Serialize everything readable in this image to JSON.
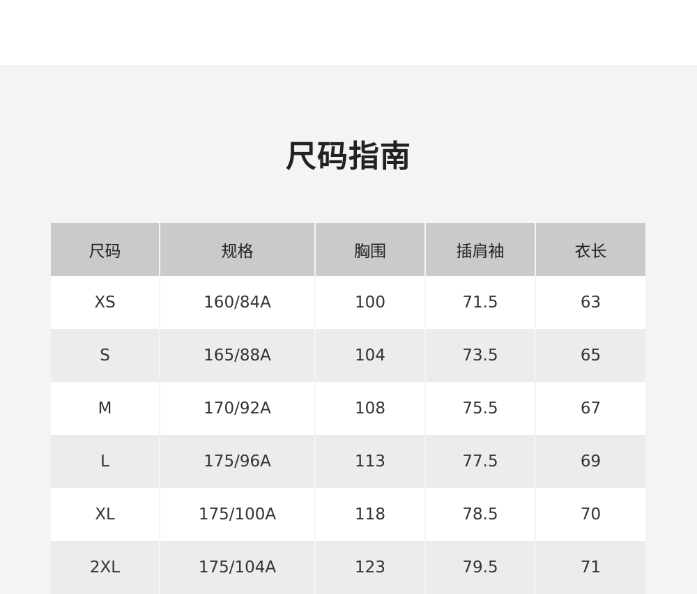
{
  "title": "尺码指南",
  "table": {
    "headers": [
      "尺码",
      "规格",
      "胸围",
      "插肩袖",
      "衣长"
    ],
    "rows": [
      [
        "XS",
        "160/84A",
        "100",
        "71.5",
        "63"
      ],
      [
        "S",
        "165/88A",
        "104",
        "73.5",
        "65"
      ],
      [
        "M",
        "170/92A",
        "108",
        "75.5",
        "67"
      ],
      [
        "L",
        "175/96A",
        "113",
        "77.5",
        "69"
      ],
      [
        "XL",
        "175/100A",
        "118",
        "78.5",
        "70"
      ],
      [
        "2XL",
        "175/104A",
        "123",
        "79.5",
        "71"
      ]
    ]
  },
  "colors": {
    "panel_background": "#f4f4f4",
    "header_background": "#cacaca",
    "row_odd": "#ffffff",
    "row_even": "#ececec",
    "text": "#222222"
  }
}
